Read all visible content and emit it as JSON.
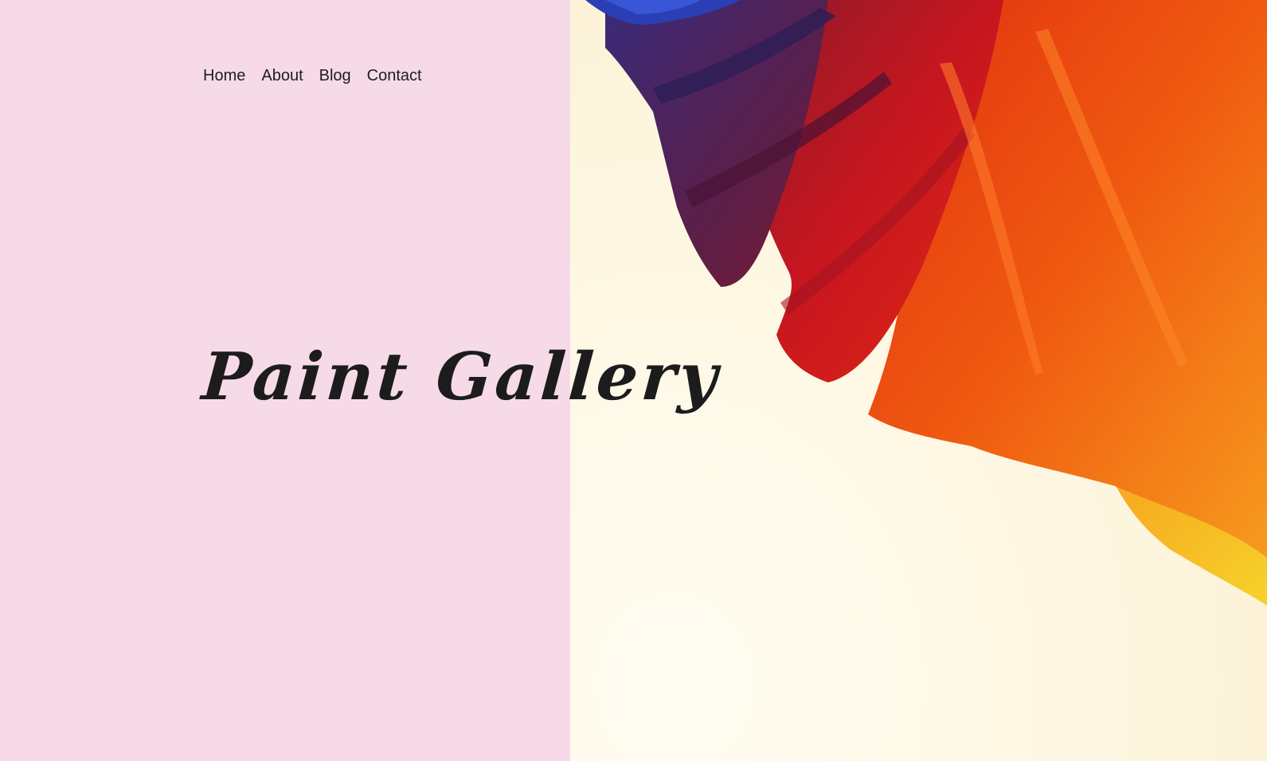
{
  "nav": {
    "items": [
      {
        "label": "Home"
      },
      {
        "label": "About"
      },
      {
        "label": "Blog"
      },
      {
        "label": "Contact"
      }
    ]
  },
  "hero": {
    "title": "Paint Gallery"
  },
  "colors": {
    "left_panel_bg": "#f6dae7",
    "right_panel_bg": "#fdf6df",
    "text": "#1c1c1c",
    "stroke_blue": "#2a3fb3",
    "stroke_purple": "#4a2a6e",
    "stroke_maroon": "#6e1f3a",
    "stroke_red": "#c8161f",
    "stroke_orange": "#ee4d0f",
    "stroke_amber": "#f7921c",
    "stroke_yellow": "#f6cf2a"
  },
  "images": {
    "hero_background": "abstract paint brush strokes"
  }
}
